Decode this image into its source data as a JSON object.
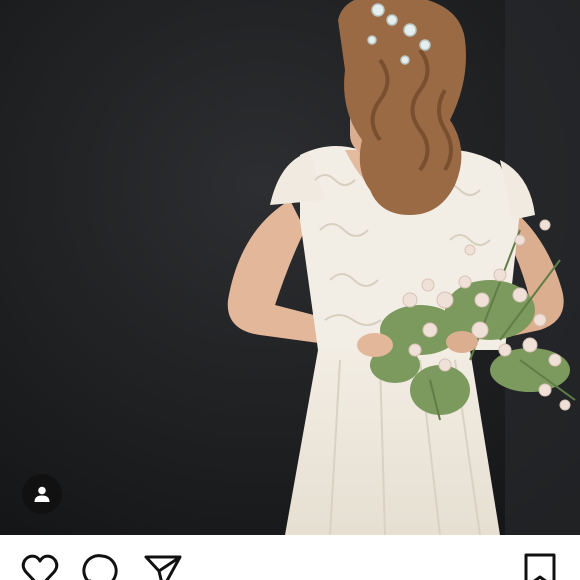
{
  "post": {
    "photo": {
      "subject_icon": "bride-photo",
      "colors": {
        "backdrop": "#1e1f21",
        "dress": "#f4efe6",
        "hair": "#9a6a45",
        "skin": "#e2b79a",
        "flowers": "#efe0d8",
        "foliage": "#7d9a5e"
      }
    },
    "user_tag": {
      "icon": "person-icon"
    },
    "actions": {
      "like": {
        "icon": "heart-icon"
      },
      "comment": {
        "icon": "comment-icon"
      },
      "share": {
        "icon": "send-icon"
      },
      "save": {
        "icon": "bookmark-icon"
      }
    }
  }
}
